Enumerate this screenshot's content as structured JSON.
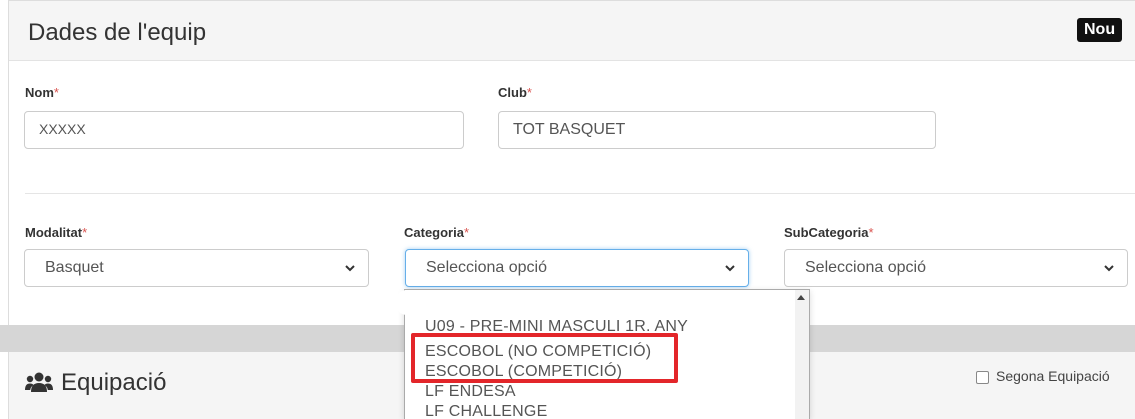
{
  "team_panel": {
    "title": "Dades de l'equip",
    "badge": "Nou",
    "required_mark": "*",
    "nom": {
      "label": "Nom",
      "value": "XXXXX"
    },
    "club": {
      "label": "Club",
      "value": "TOT BASQUET"
    },
    "modalitat": {
      "label": "Modalitat",
      "selected": "Basquet"
    },
    "categoria": {
      "label": "Categoria",
      "selected": "Selecciona opció"
    },
    "subcategoria": {
      "label": "SubCategoria",
      "selected": "Selecciona opció"
    }
  },
  "categoria_dropdown": {
    "options": [
      "U09 - PRE-MINI MASCULI 1R. ANY",
      "ESCOBOL (NO COMPETICIÓ)",
      "ESCOBOL (COMPETICIÓ)",
      "LF ENDESA",
      "LF CHALLENGE"
    ],
    "highlight_color": "#e3262a"
  },
  "equipacio_panel": {
    "title": "Equipació",
    "icon": "users-icon",
    "second_kit_label": "Segona Equipació",
    "second_kit_checked": false
  }
}
